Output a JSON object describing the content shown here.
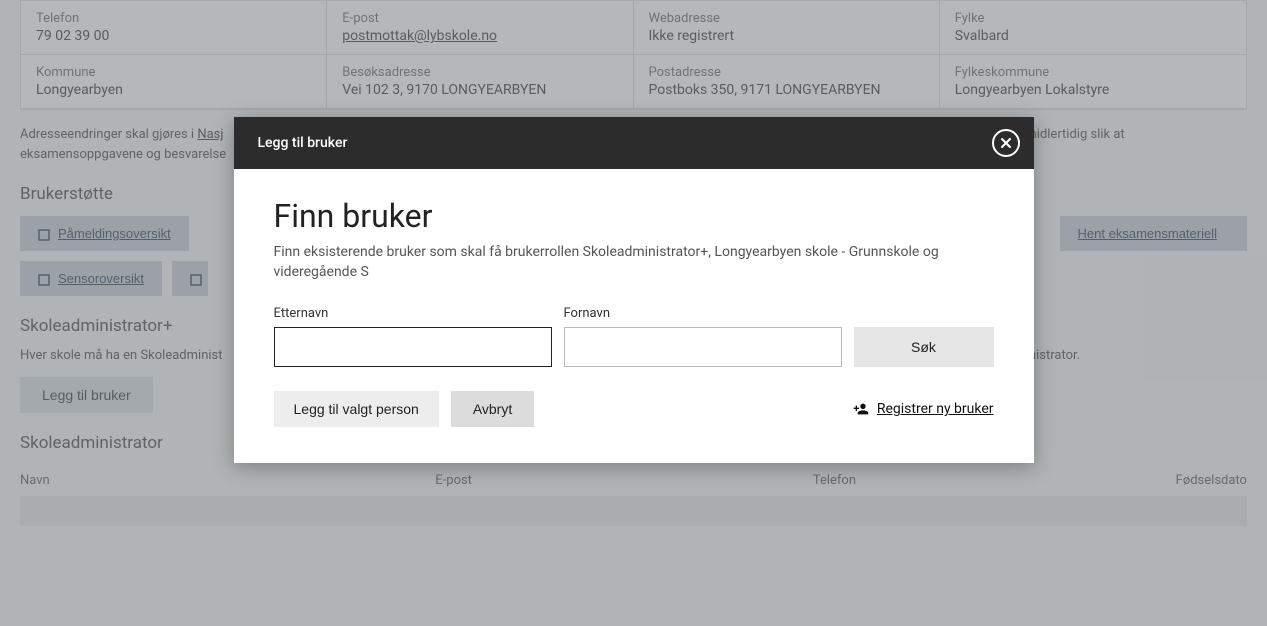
{
  "bg": {
    "info": [
      {
        "label": "Telefon",
        "value": "79 02 39 00"
      },
      {
        "label": "E-post",
        "value": "postmottak@lybskole.no",
        "is_link": true
      },
      {
        "label": "Webadresse",
        "value": "Ikke registrert"
      },
      {
        "label": "Fylke",
        "value": "Svalbard"
      },
      {
        "label": "Kommune",
        "value": "Longyearbyen"
      },
      {
        "label": "Besøksadresse",
        "value": "Vei 102 3, 9170 LONGYEARBYEN"
      },
      {
        "label": "Postadresse",
        "value": "Postboks 350, 9171 LONGYEARBYEN"
      },
      {
        "label": "Fylkeskommune",
        "value": "Longyearbyen Lokalstyre"
      }
    ],
    "note_prefix": "Adresseendringer skal gjøres i ",
    "note_link": "Nasj",
    "note_suffix": "ressen midlertidig slik at eksamensoppgavene og besvarelse",
    "support_title": "Brukerstøtte",
    "buttons": {
      "pameldings": "Påmeldingsoversikt",
      "sensor": "Sensoroversikt",
      "hent": "Hent eksamensmateriell"
    },
    "section2_title": "Skoleadministrator+",
    "section2_para": "Hver skole må ha en Skoleadminist",
    "section2_para_end": "oleadministrator.",
    "add_user_btn": "Legg til bruker",
    "section3_title": "Skoleadministrator",
    "table_headers": {
      "navn": "Navn",
      "epost": "E-post",
      "telefon": "Telefon",
      "fodselsdato": "Fødselsdato"
    }
  },
  "modal": {
    "header_title": "Legg til bruker",
    "title": "Finn bruker",
    "description": "Finn eksisterende bruker som skal få brukerrollen Skoleadministrator+, Longyearbyen skole - Grunnskole og videregående S",
    "etternavn_label": "Etternavn",
    "fornavn_label": "Fornavn",
    "search_btn": "Søk",
    "add_selected_btn": "Legg til valgt person",
    "cancel_btn": "Avbryt",
    "register_link": "Registrer ny bruker"
  }
}
